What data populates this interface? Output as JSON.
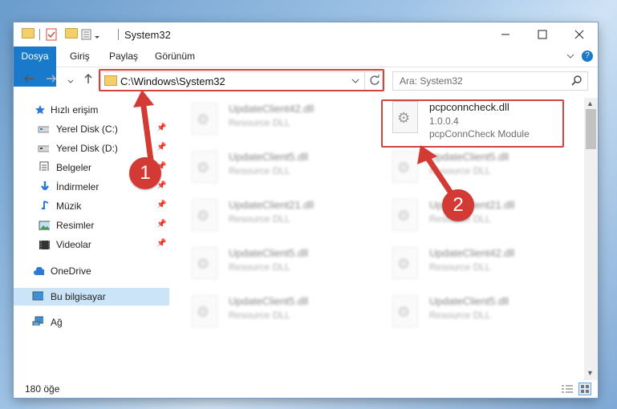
{
  "window": {
    "title": "System32"
  },
  "ribbon": {
    "tabs": [
      "Dosya",
      "Giriş",
      "Paylaş",
      "Görünüm"
    ]
  },
  "address": {
    "path": "C:\\Windows\\System32"
  },
  "search": {
    "placeholder": "Ara: System32"
  },
  "nav": {
    "quick_access": "Hızlı erişim",
    "items": [
      {
        "label": "Yerel Disk (C:)",
        "icon": "drive-icon",
        "pinned": true
      },
      {
        "label": "Yerel Disk (D:)",
        "icon": "drive-icon",
        "pinned": true
      },
      {
        "label": "Belgeler",
        "icon": "documents-icon",
        "pinned": true
      },
      {
        "label": "İndirmeler",
        "icon": "download-icon",
        "pinned": true
      },
      {
        "label": "Müzik",
        "icon": "music-icon",
        "pinned": true
      },
      {
        "label": "Resimler",
        "icon": "pictures-icon",
        "pinned": true
      },
      {
        "label": "Videolar",
        "icon": "videos-icon",
        "pinned": true
      }
    ],
    "onedrive": "OneDrive",
    "this_pc": "Bu bilgisayar",
    "network": "Ağ"
  },
  "files": {
    "left": [
      {
        "name": "UpdateClient42.dll",
        "type": "Resource DLL"
      },
      {
        "name": "UpdateClient5.dll",
        "type": "Resource DLL"
      },
      {
        "name": "UpdateClient21.dll",
        "type": "Resource DLL"
      },
      {
        "name": "UpdateClient5.dll",
        "type": "Resource DLL"
      },
      {
        "name": "UpdateClient5.dll",
        "type": "Resource DLL"
      }
    ],
    "right": [
      {
        "name": "pcpconncheck.dll",
        "version": "1.0.0.4",
        "type": "pcpConnCheck Module"
      },
      {
        "name": "UpdateClient5.dll",
        "type": "Resource DLL"
      },
      {
        "name": "UpdateClient21.dll",
        "type": "Resource DLL"
      },
      {
        "name": "UpdateClient42.dll",
        "type": "Resource DLL"
      },
      {
        "name": "UpdateClient5.dll",
        "type": "Resource DLL"
      }
    ]
  },
  "status": {
    "count": "180 öğe"
  },
  "callouts": {
    "one": "1",
    "two": "2"
  },
  "colors": {
    "accent": "#1979ca",
    "highlight": "#d0453d",
    "selected": "#cce4f7"
  }
}
